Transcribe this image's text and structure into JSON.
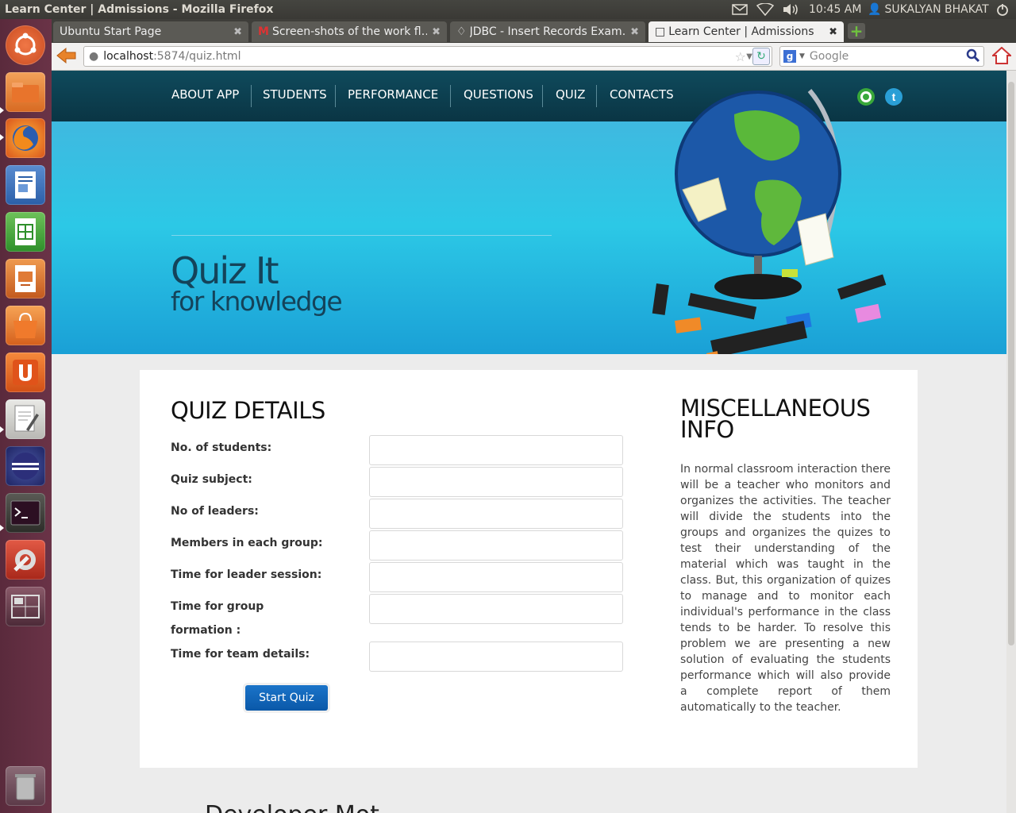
{
  "system": {
    "window_title": "Learn Center | Admissions - Mozilla Firefox",
    "time": "10:45 AM",
    "user": "SUKALYAN BHAKAT"
  },
  "launcher": {
    "items": [
      "ubuntu-dash",
      "home-folder",
      "firefox",
      "libreoffice-writer",
      "libreoffice-calc",
      "libreoffice-impress",
      "software-center",
      "ubuntu-one",
      "text-editor",
      "eclipse",
      "terminal",
      "system-settings",
      "workspace-switcher",
      "trash"
    ]
  },
  "browser": {
    "tabs": [
      {
        "label": "Ubuntu Start Page"
      },
      {
        "label": "Screen-shots of the work fl…"
      },
      {
        "label": "JDBC - Insert Records Exam…"
      },
      {
        "label": "Learn Center | Admissions"
      }
    ],
    "url_host": "localhost",
    "url_rest": ":5874/quiz.html",
    "search_placeholder": "Google"
  },
  "site": {
    "nav": [
      "ABOUT APP",
      "STUDENTS",
      "PERFORMANCE",
      "QUESTIONS",
      "QUIZ",
      "CONTACTS"
    ],
    "hero_title": "Quiz It",
    "hero_subtitle": "for knowledge",
    "quiz_heading": "QUIZ DETAILS",
    "fields": [
      "No. of students:",
      "Quiz subject:",
      "No of leaders:",
      "Members in each group:",
      "Time for leader session:",
      "Time for group formation :",
      "Time for team details:"
    ],
    "start_button": "Start Quiz",
    "misc_heading": "MISCELLANEOUS INFO",
    "misc_text": "In normal classroom interaction there will be a teacher who monitors and organizes the activities. The teacher will divide the students into the groups and organizes the quizes to test their understanding of the material which was taught in the class. But, this organization of quizes to manage and to monitor each individual's performance in the class tends to be harder. To resolve this problem we are presenting a new solution of evaluating the students performance which will also provide a complete report of them automatically to the teacher.",
    "footer_peek": "Developer  Mot"
  }
}
